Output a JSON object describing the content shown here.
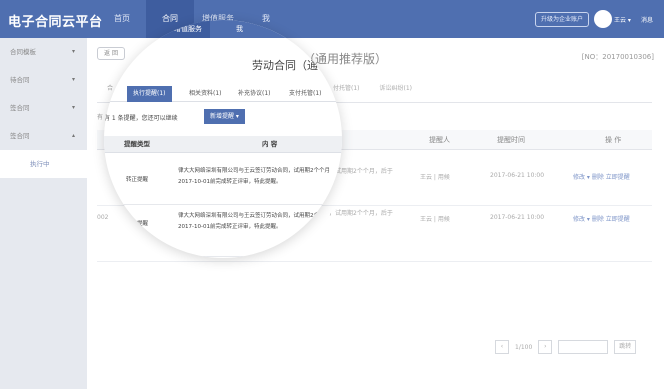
{
  "app": {
    "title": "电子合同云平台"
  },
  "topnav": [
    {
      "label": "首页",
      "active": false
    },
    {
      "label": "合同",
      "active": true
    },
    {
      "label": "增值服务",
      "active": false
    },
    {
      "label": "我",
      "active": false
    }
  ],
  "header": {
    "upgrade_label": "升级为企业账户",
    "user_name": "王云 ▾",
    "messages_label": "消息"
  },
  "sidebar": {
    "items": [
      {
        "label": "合同模板",
        "chevron": "▾"
      },
      {
        "label": "待合同",
        "chevron": "▾"
      },
      {
        "label": "签合同",
        "chevron": "▾"
      },
      {
        "label": "签合同",
        "chevron": "▴"
      }
    ],
    "active_sub": "执行中"
  },
  "main": {
    "back_label": "返 回",
    "title_visible": "合同（通用推荐版）",
    "doc_no": "[NO：20170010306]",
    "tabs_visible": [
      "合",
      "付托管(1)",
      "诉讼纠纷(1)"
    ],
    "reminder_partial": "有 1 条提醒，",
    "columns": {
      "reminder_person": "提醒人",
      "reminder_time": "提醒时间",
      "actions": "操 作"
    },
    "rows": [
      {
        "content_tail": "，试用期2个个月，后于",
        "person": "王云 | 用候",
        "time": "2017-06-21 10:00",
        "actions": "修改 ▾ 删除  立即提醒"
      },
      {
        "prefix": "002",
        "content_tail": "，试用期2个个月，后于",
        "person": "王云 | 用候",
        "time": "2017-06-21 10:00",
        "actions": "修改 ▾ 删除  立即提醒"
      }
    ],
    "pager": {
      "prev": "‹",
      "info": "1/100",
      "next": "›",
      "go_label": "跳转"
    }
  },
  "lens": {
    "topnav": [
      "增值服务",
      "我"
    ],
    "title": "劳动合同（通",
    "tabs": [
      {
        "label": "执行提醒(1)",
        "active": true
      },
      {
        "label": "相关资料(1)",
        "active": false
      },
      {
        "label": "补充协议(1)",
        "active": false
      },
      {
        "label": "支付托管(1)",
        "active": false
      }
    ],
    "reminder_text": "有  1  条提醒，您还可以继续",
    "add_button": "新增提醒 ▾",
    "columns": {
      "type": "提醒类型",
      "content": "内 容"
    },
    "rows": [
      {
        "type": "转正提醒",
        "content_line1": "律大大网络深圳有限公司与王云签订劳动合同，试用期2个个月",
        "content_line2": "2017-10-01前完成转正评审，特此提醒。"
      },
      {
        "type": "转正提醒",
        "content_line1": "律大大网络深圳有限公司与王云签订劳动合同，试用期2个个月",
        "content_line2": "2017-10-01前完成转正评审，特此提醒。"
      }
    ]
  }
}
